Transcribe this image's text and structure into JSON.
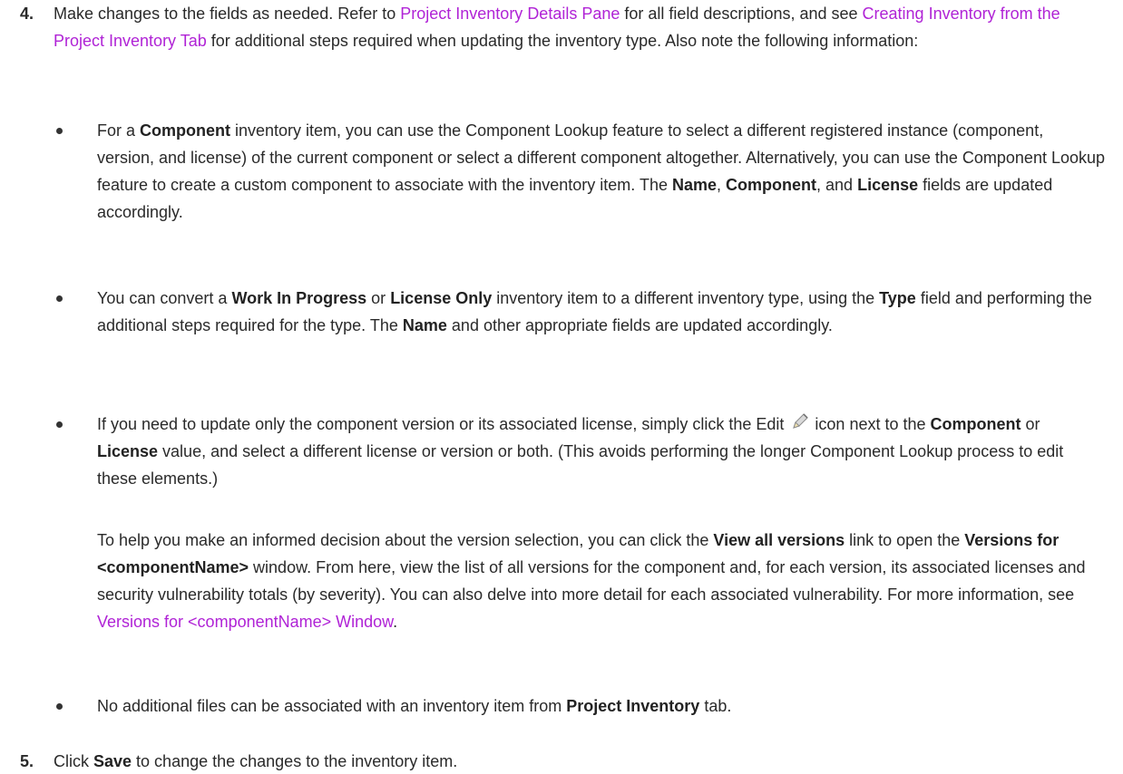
{
  "step4": {
    "number": "4.",
    "text_a": "Make changes to the fields as needed. Refer to ",
    "link_a": "Project Inventory Details Pane",
    "text_b": " for all field descriptions, and see ",
    "link_b": "Creating Inventory from the Project Inventory Tab",
    "text_c": " for additional steps required when updating the inventory type. Also note the following information:"
  },
  "bullets": [
    {
      "t1": "For a ",
      "b1": "Component",
      "t2": " inventory item, you can use the Component Lookup feature to select a different registered instance (component, version, and license) of the current component or select a different component altogether. Alternatively, you can use the Component Lookup feature to create a custom component to associate with the inventory item. The ",
      "b2": "Name",
      "t3": ", ",
      "b3": "Component",
      "t4": ", and ",
      "b4": "License",
      "t5": " fields are updated accordingly."
    },
    {
      "t1": "You can convert a ",
      "b1": "Work In Progress",
      "t2": " or ",
      "b2": "License Only",
      "t3": " inventory item to a different inventory type, using the ",
      "b3": "Type",
      "t4": " field and performing the additional steps required for the type. The ",
      "b4": "Name",
      "t5": " and other appropriate fields are updated accordingly."
    },
    {
      "t1": "If you need to update only the component version or its associated license, simply click the Edit ",
      "icon": "pencil-edit-icon",
      "t2": " icon next to the ",
      "b1": "Component",
      "t3": " or ",
      "b2": "License",
      "t4": " value, and select a different license or version or both. (This avoids performing the longer Component Lookup process to edit these elements.)"
    },
    {
      "t1": "No additional files can be associated with an inventory item from ",
      "b1": "Project Inventory",
      "t2": " tab."
    }
  ],
  "versions_para": {
    "t1": "To help you make an informed decision about the version selection, you can click the ",
    "b1": "View all versions",
    "t2": " link to open the ",
    "b2": "Versions for <componentName>",
    "t3": " window. From here, view the list of all versions for the component and, for each version, its associated licenses and security vulnerability totals (by severity). You can also delve into more detail for each associated vulnerability. For more information, see ",
    "link": "Versions for <componentName> Window",
    "t4": "."
  },
  "step5": {
    "number": "5.",
    "t1": "Click ",
    "b1": "Save",
    "t2": " to change the changes to the inventory item."
  },
  "colors": {
    "link": "#b023d6",
    "text": "#2a2a2a"
  }
}
